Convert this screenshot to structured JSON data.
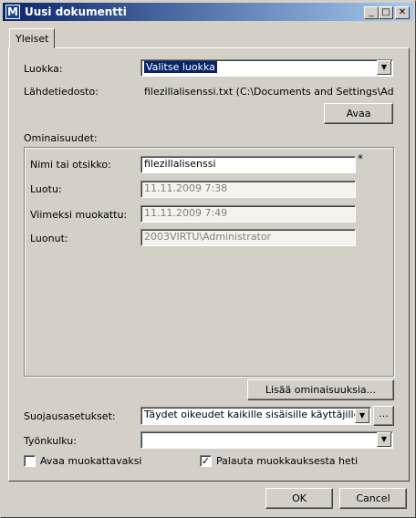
{
  "window": {
    "title": "Uusi dokumentti",
    "icon": "M",
    "controls": {
      "minimize": "_",
      "maximize": "□",
      "close": "✕"
    }
  },
  "tabs": [
    {
      "label": "Yleiset"
    }
  ],
  "form": {
    "class_label": "Luokka:",
    "class_value": "Valitse luokka",
    "source_label": "Lähdetiedosto:",
    "source_value": "filezillalisenssi.txt  (C:\\Documents and Settings\\Administ",
    "open_button": "Avaa"
  },
  "properties": {
    "group_label": "Ominaisuudet:",
    "rows": [
      {
        "label": "Nimi tai otsikko:",
        "value": "filezillalisenssi",
        "required": "*"
      },
      {
        "label": "Luotu:",
        "value": "11.11.2009 7:38"
      },
      {
        "label": "Viimeksi muokattu:",
        "value": "11.11.2009 7:49"
      },
      {
        "label": "Luonut:",
        "value": "2003VIRTU\\Administrator"
      }
    ],
    "add_button": "Lisää ominaisuuksia..."
  },
  "security": {
    "label": "Suojausasetukset:",
    "value": "Täydet oikeudet kaikille sisäisille käyttäjille",
    "more_button": "..."
  },
  "workflow": {
    "label": "Työnkulku:",
    "value": ""
  },
  "checkboxes": {
    "open_editable": {
      "label": "Avaa muokattavaksi",
      "checked": false
    },
    "restore_edit": {
      "label": "Palauta muokkauksesta heti",
      "checked": true
    }
  },
  "buttons": {
    "ok": "OK",
    "cancel": "Cancel"
  }
}
